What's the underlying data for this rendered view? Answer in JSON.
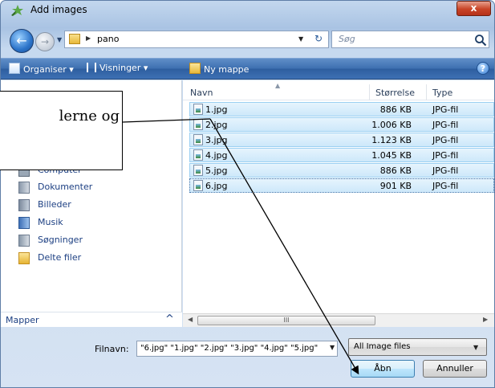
{
  "window": {
    "title": "Add images",
    "close_glyph": "x"
  },
  "address": {
    "separator": "▶",
    "current_folder": "pano",
    "dropdown": "▼",
    "refresh_glyph": "↻"
  },
  "search": {
    "placeholder": "Søg",
    "icon": "search-icon"
  },
  "toolbar": {
    "organise_label": "Organiser ▾",
    "views_label": "Visninger ▾",
    "new_folder_label": "Ny mappe",
    "help_glyph": "?"
  },
  "nav": {
    "partial_item": "Computer",
    "items": [
      {
        "label": "Dokumenter",
        "icon": "documents-icon"
      },
      {
        "label": "Billeder",
        "icon": "pictures-icon"
      },
      {
        "label": "Musik",
        "icon": "music-icon"
      },
      {
        "label": "Søgninger",
        "icon": "searches-icon"
      },
      {
        "label": "Delte filer",
        "icon": "shared-folder-icon"
      }
    ],
    "folders_label": "Mapper",
    "folders_chevron": "^"
  },
  "columns": {
    "name": "Navn",
    "size": "Størrelse",
    "type": "Type"
  },
  "files": [
    {
      "name": "1.jpg",
      "size": "886 KB",
      "type": "JPG-fil"
    },
    {
      "name": "2.jpg",
      "size": "1.006 KB",
      "type": "JPG-fil"
    },
    {
      "name": "3.jpg",
      "size": "1.123 KB",
      "type": "JPG-fil"
    },
    {
      "name": "4.jpg",
      "size": "1.045 KB",
      "type": "JPG-fil"
    },
    {
      "name": "5.jpg",
      "size": "886 KB",
      "type": "JPG-fil"
    },
    {
      "name": "6.jpg",
      "size": "901 KB",
      "type": "JPG-fil"
    }
  ],
  "scroll": {
    "thumb_grip": "III"
  },
  "filename": {
    "label": "Filnavn:",
    "value": "\"6.jpg\" \"1.jpg\" \"2.jpg\" \"3.jpg\" \"4.jpg\" \"5.jpg\""
  },
  "filetype": {
    "selected": "All Image files"
  },
  "buttons": {
    "open": "Åbn",
    "cancel": "Annuller"
  },
  "callout": {
    "text": "lerne og"
  }
}
